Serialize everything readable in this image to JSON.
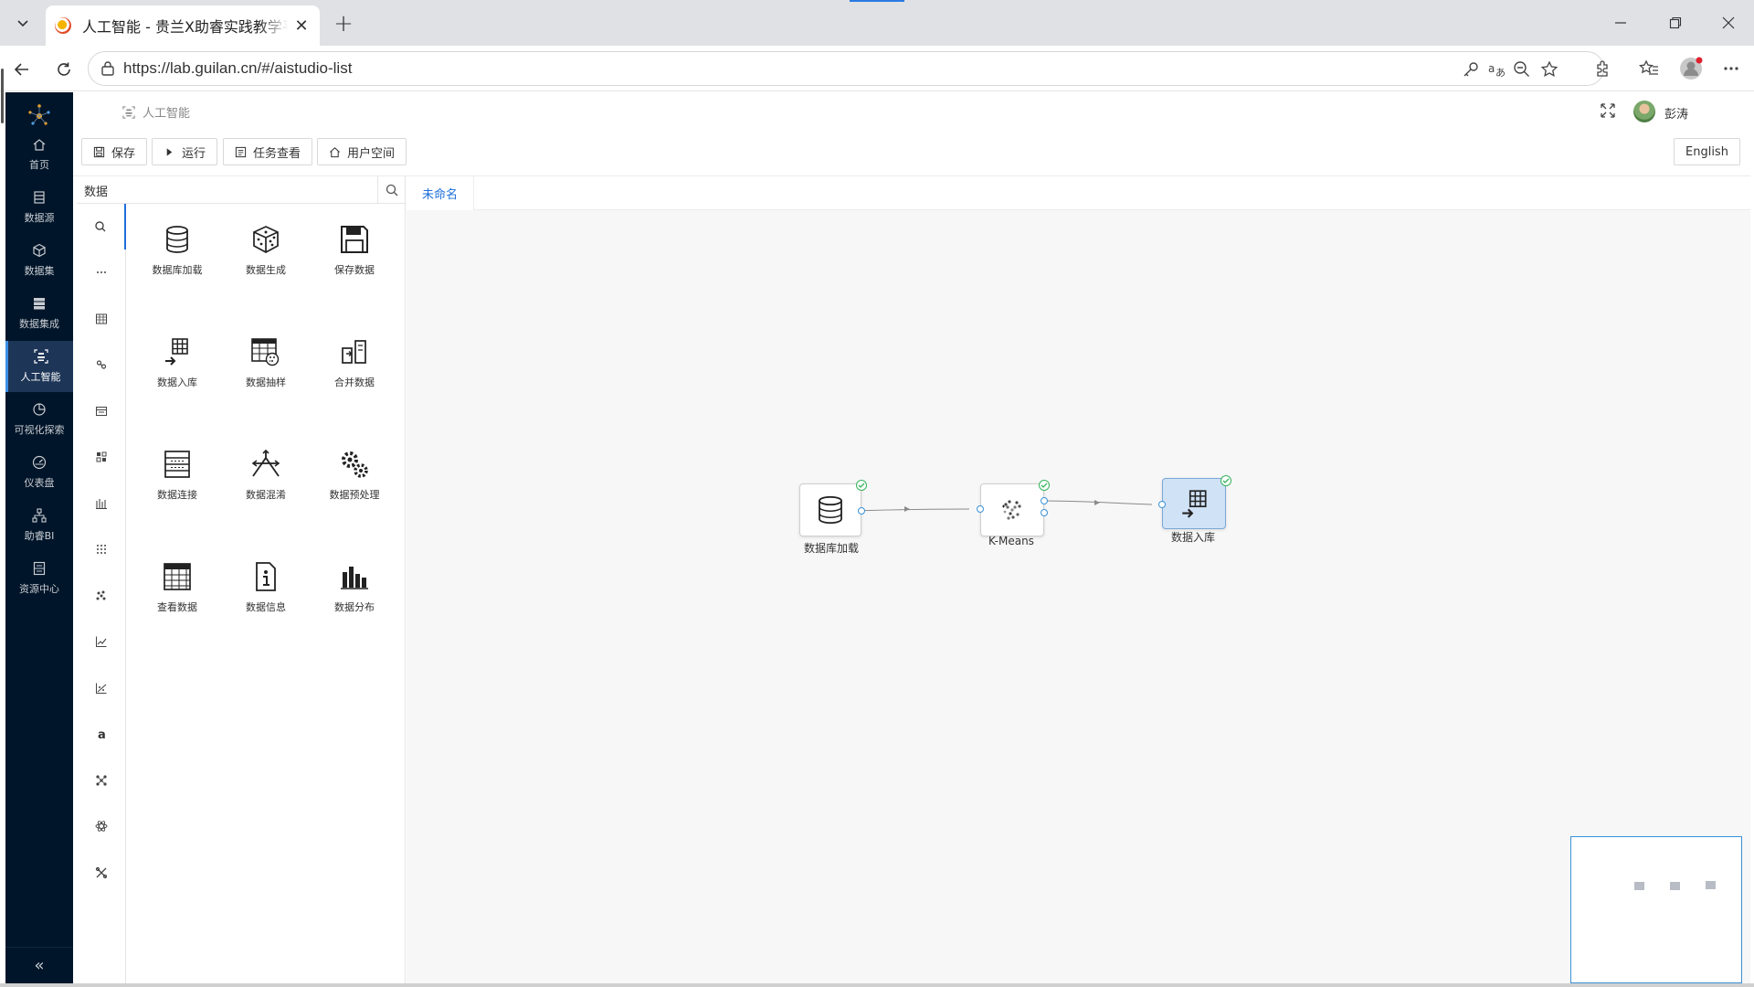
{
  "browser": {
    "tab_title": "人工智能 - 贵兰X助睿实践教学平台",
    "url": "https://lab.guilan.cn/#/aistudio-list"
  },
  "sidebar": {
    "items": [
      {
        "label": "首页",
        "icon": "home-icon"
      },
      {
        "label": "数据源",
        "icon": "datasource-icon"
      },
      {
        "label": "数据集",
        "icon": "dataset-icon"
      },
      {
        "label": "数据集成",
        "icon": "integration-icon"
      },
      {
        "label": "人工智能",
        "icon": "ai-icon",
        "active": true
      },
      {
        "label": "可视化探索",
        "icon": "pie-chart-icon"
      },
      {
        "label": "仪表盘",
        "icon": "dashboard-icon"
      },
      {
        "label": "助睿BI",
        "icon": "org-chart-icon"
      },
      {
        "label": "资源中心",
        "icon": "resource-icon"
      }
    ],
    "collapse": "«"
  },
  "header": {
    "breadcrumb": "人工智能",
    "user_name": "彭涛",
    "language": "English"
  },
  "actions": {
    "save": "保存",
    "run": "运行",
    "tasks": "任务查看",
    "user_space": "用户空间"
  },
  "component_panel": {
    "search_value": "数据",
    "items": [
      {
        "label": "数据库加载",
        "icon": "database-icon"
      },
      {
        "label": "数据生成",
        "icon": "dice-icon"
      },
      {
        "label": "保存数据",
        "icon": "floppy-icon"
      },
      {
        "label": "数据入库",
        "icon": "grid-import-icon"
      },
      {
        "label": "数据抽样",
        "icon": "sample-table-icon"
      },
      {
        "label": "合并数据",
        "icon": "merge-icon"
      },
      {
        "label": "数据连接",
        "icon": "join-icon"
      },
      {
        "label": "数据混淆",
        "icon": "shuffle-icon"
      },
      {
        "label": "数据预处理",
        "icon": "gears-icon"
      },
      {
        "label": "查看数据",
        "icon": "table-icon"
      },
      {
        "label": "数据信息",
        "icon": "info-doc-icon"
      },
      {
        "label": "数据分布",
        "icon": "bar-chart-icon"
      }
    ]
  },
  "canvas": {
    "tab": "未命名",
    "nodes": [
      {
        "label": "数据库加载",
        "icon": "database-icon",
        "status": "success"
      },
      {
        "label": "K-Means",
        "icon": "cluster-icon",
        "status": "success"
      },
      {
        "label": "数据入库",
        "icon": "grid-import-icon",
        "status": "success",
        "selected": true
      }
    ]
  }
}
